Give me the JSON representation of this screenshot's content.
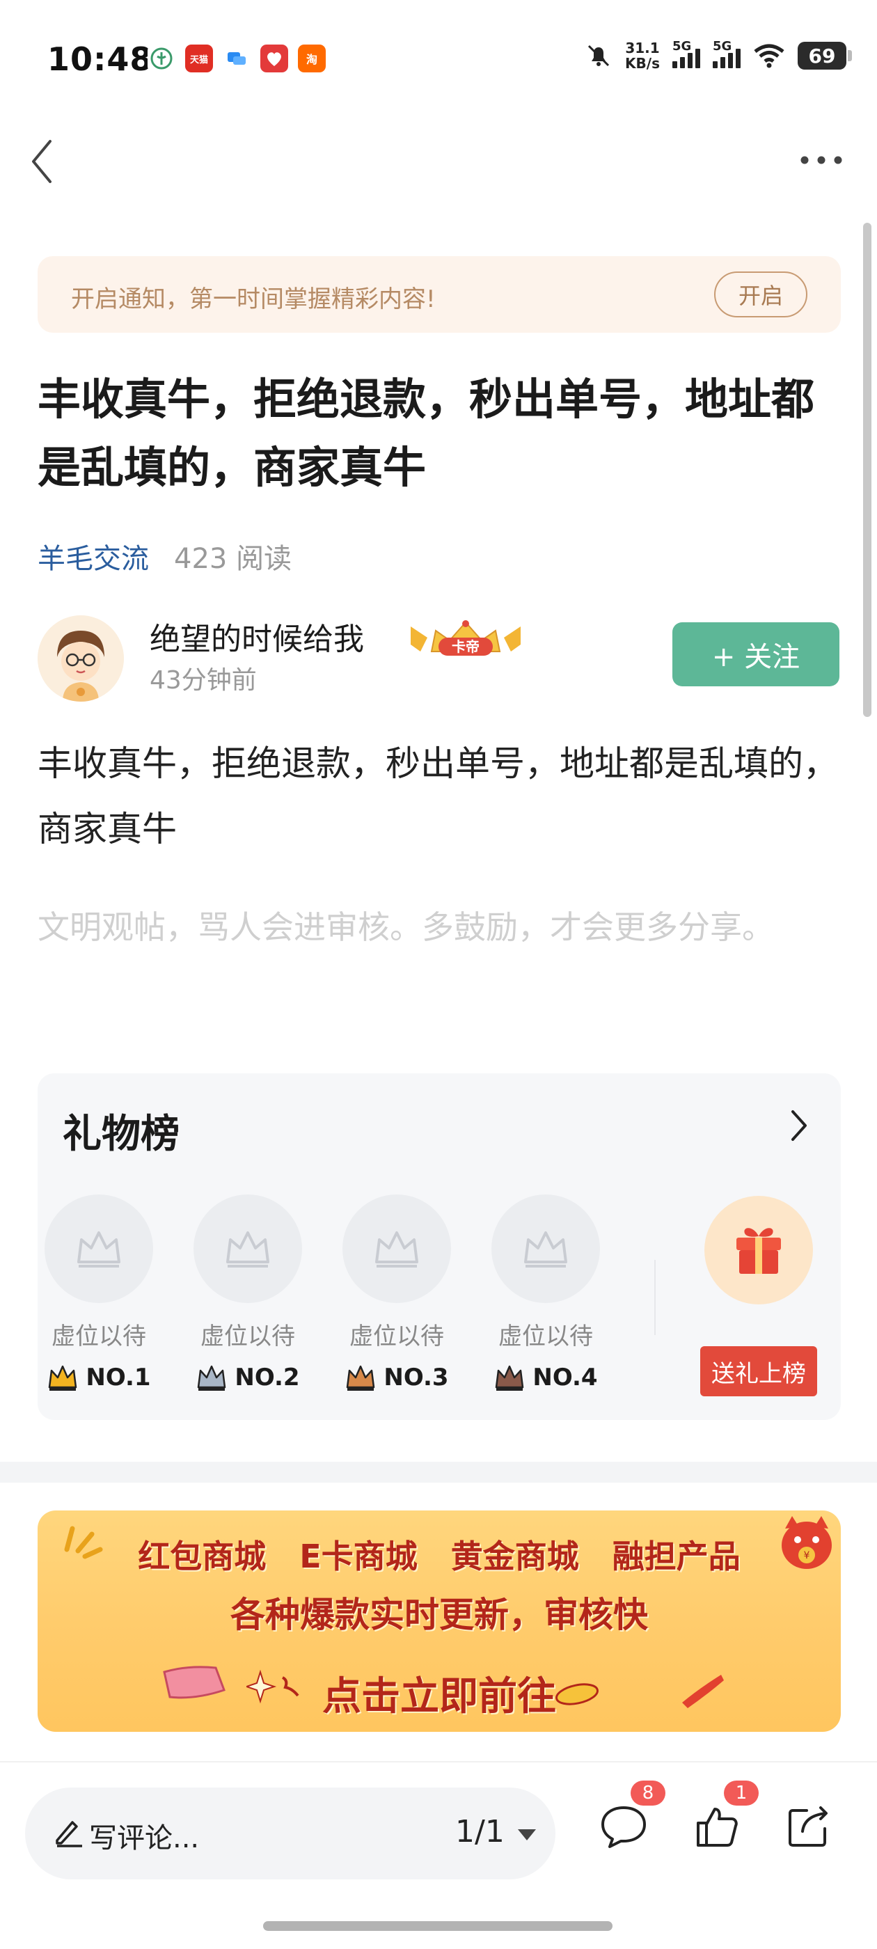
{
  "status_bar": {
    "time": "10:48",
    "net_speed_value": "31.1",
    "net_speed_unit": "KB/s",
    "signal1": "5G",
    "signal2": "5G",
    "battery": "69",
    "apps": [
      "天猫",
      "淘"
    ]
  },
  "notice": {
    "text": "开启通知，第一时间掌握精彩内容!",
    "button": "开启"
  },
  "post": {
    "title": "丰收真牛，拒绝退款，秒出单号，地址都是乱填的，商家真牛",
    "forum": "羊毛交流",
    "reads": "423 阅读",
    "body": "丰收真牛，拒绝退款，秒出单号，地址都是乱填的，商家真牛",
    "hint": "文明观帖，骂人会进审核。多鼓励，才会更多分享。"
  },
  "author": {
    "name": "绝望的时候给我",
    "badge": "卡帝",
    "time": "43分钟前",
    "follow_button": "+ 关注"
  },
  "gift_board": {
    "title": "礼物榜",
    "slots": [
      {
        "label": "虚位以待",
        "rank": "NO.1",
        "crown_color": "#f2b321"
      },
      {
        "label": "虚位以待",
        "rank": "NO.2",
        "crown_color": "#a9b6c6"
      },
      {
        "label": "虚位以待",
        "rank": "NO.3",
        "crown_color": "#d7894a"
      },
      {
        "label": "虚位以待",
        "rank": "NO.4",
        "crown_color": "#8a5a4a"
      }
    ],
    "send_button": "送礼上榜"
  },
  "banner": {
    "row1": [
      "红包商城",
      "E卡商城",
      "黄金商城",
      "融担产品"
    ],
    "row2": "各种爆款实时更新，审核快",
    "row3": "点击立即前往"
  },
  "bottom_bar": {
    "comment_placeholder": "写评论...",
    "page_indicator": "1/1",
    "comment_count": "8",
    "like_count": "1"
  },
  "colors": {
    "accent_green": "#5db797",
    "forum_blue": "#2a5d9e",
    "badge_red": "#f25a57",
    "gift_red": "#e24a3b"
  }
}
